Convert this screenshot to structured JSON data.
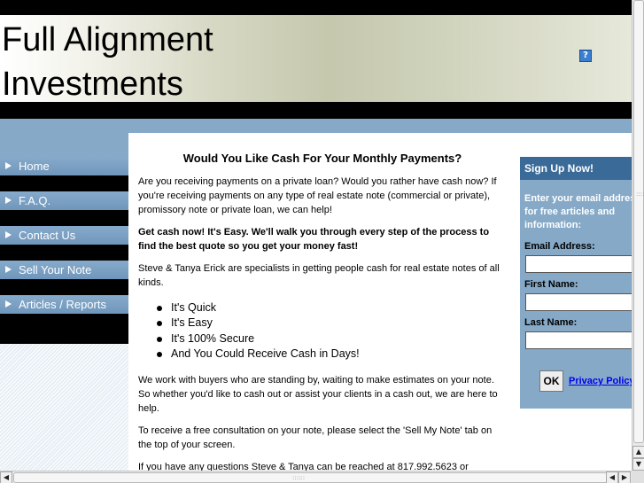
{
  "header": {
    "title": "Full Alignment Investments",
    "help_icon": "?"
  },
  "nav": {
    "items": [
      {
        "label": "Home"
      },
      {
        "label": "F.A.Q."
      },
      {
        "label": "Contact Us"
      },
      {
        "label": "Sell Your Note"
      },
      {
        "label": "Articles / Reports"
      }
    ]
  },
  "main": {
    "heading": "Would You Like Cash For Your Monthly Payments?",
    "p1": "Are you receiving payments on a private loan? Would you rather have cash now? If you're receiving payments on any type of real estate note (commercial or private), promissory note or private loan, we can help!",
    "p2": "Get cash now! It's Easy. We'll walk you through every step of the process to find the best quote so you get your money fast!",
    "p3": "Steve & Tanya Erick are specialists in getting people cash for real estate notes of all kinds.",
    "bullets": [
      "It's Quick",
      "It's Easy",
      "It's 100% Secure",
      "And You Could Receive Cash in Days!"
    ],
    "p4": "We work with buyers who are standing by, waiting to make estimates on your note. So whether you'd like to cash out or assist your clients in a cash out, we are here to help.",
    "p5": "To receive a free consultation on your note, please select the 'Sell My Note' tab on the top of your screen.",
    "p6": "If you have any questions Steve & Tanya can be reached at 817.992.5623 or"
  },
  "signup": {
    "title": "Sign Up Now!",
    "intro": "Enter your email address for free articles and information:",
    "email_label": "Email Address:",
    "first_label": "First Name:",
    "last_label": "Last Name:",
    "email_value": "",
    "first_value": "",
    "last_value": "",
    "ok_label": "OK",
    "privacy_label": "Privacy Policy"
  },
  "scrollbars": {
    "up": "▲",
    "down": "▼",
    "left": "◀",
    "right": "▶",
    "grip": "::::::"
  },
  "colors": {
    "nav_blue": "#85a9c7",
    "signup_head": "#3a6a97",
    "link": "#0000ee"
  }
}
